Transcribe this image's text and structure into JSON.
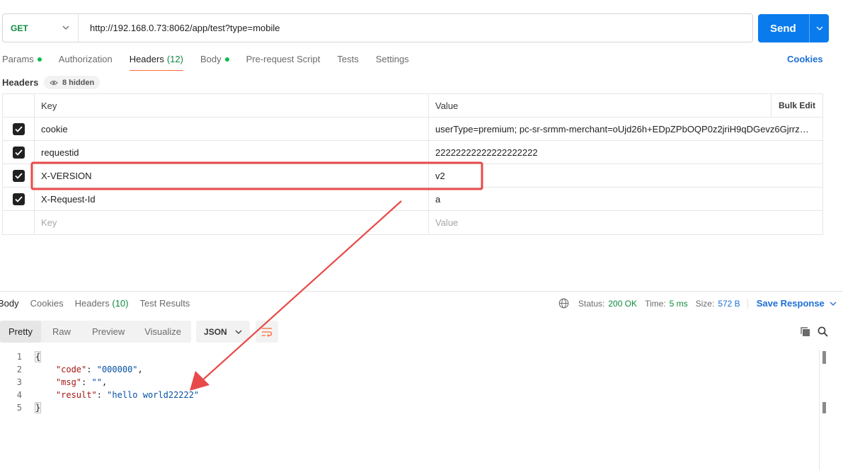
{
  "request": {
    "method": "GET",
    "url": "http://192.168.0.73:8062/app/test?type=mobile",
    "send_label": "Send"
  },
  "tabs": {
    "params": "Params",
    "authorization": "Authorization",
    "headers": "Headers",
    "headers_count": "(12)",
    "body": "Body",
    "prerequest": "Pre-request Script",
    "tests": "Tests",
    "settings": "Settings",
    "cookies": "Cookies"
  },
  "headers_section": {
    "label": "Headers",
    "hidden": "8 hidden",
    "col_key": "Key",
    "col_value": "Value",
    "bulk_edit": "Bulk Edit",
    "rows": [
      {
        "key": "cookie",
        "value": "userType=premium; pc-sr-srmm-merchant=oUjd26h+EDpZPbOQP0z2jriH9qDGevz6Gjrrz…"
      },
      {
        "key": "requestid",
        "value": "22222222222222222222"
      },
      {
        "key": "X-VERSION",
        "value": "v2"
      },
      {
        "key": "X-Request-Id",
        "value": "a"
      }
    ],
    "key_placeholder": "Key",
    "value_placeholder": "Value"
  },
  "response": {
    "tabs": {
      "body": "Body",
      "cookies": "Cookies",
      "headers": "Headers",
      "headers_count": "(10)",
      "test_results": "Test Results"
    },
    "status_label": "Status:",
    "status_value": "200 OK",
    "time_label": "Time:",
    "time_value": "5 ms",
    "size_label": "Size:",
    "size_value": "572 B",
    "save": "Save Response",
    "formats": [
      "Pretty",
      "Raw",
      "Preview",
      "Visualize"
    ],
    "language": "JSON",
    "lines": [
      "1",
      "2",
      "3",
      "4",
      "5"
    ],
    "json": {
      "open": "{",
      "close": "}",
      "code_key": "\"code\"",
      "code_val": "\"000000\"",
      "msg_key": "\"msg\"",
      "msg_val": "\"\"",
      "result_key": "\"result\"",
      "result_val": "\"hello world22222\""
    }
  },
  "colors": {
    "accent": "#097bed",
    "active_tab": "#ff6c37",
    "success": "#0d8a3f",
    "annotation": "#e84a4a"
  }
}
